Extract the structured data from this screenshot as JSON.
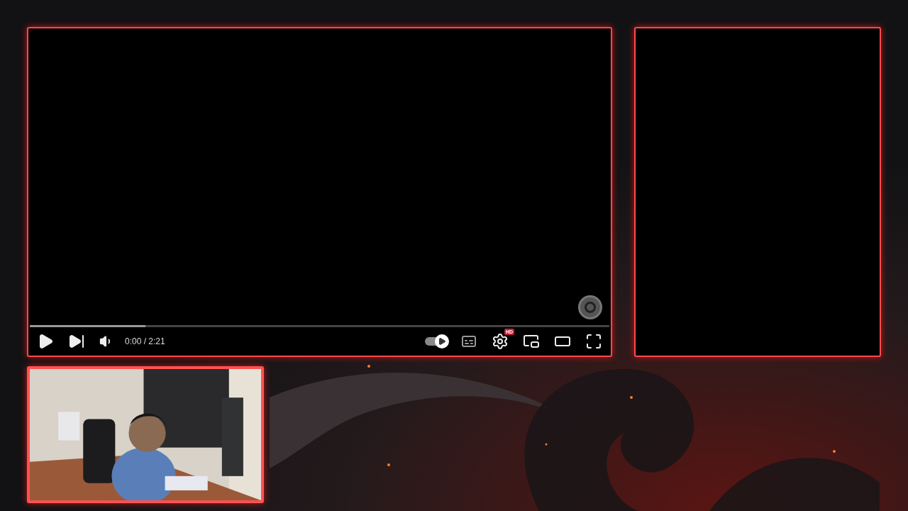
{
  "player": {
    "time": "0:00 / 2:21",
    "buffered": {
      "level": 0.2
    },
    "autoplay": {
      "on": true
    },
    "quality_badge": "HD"
  },
  "side_panel": {
    "kind": "empty"
  }
}
